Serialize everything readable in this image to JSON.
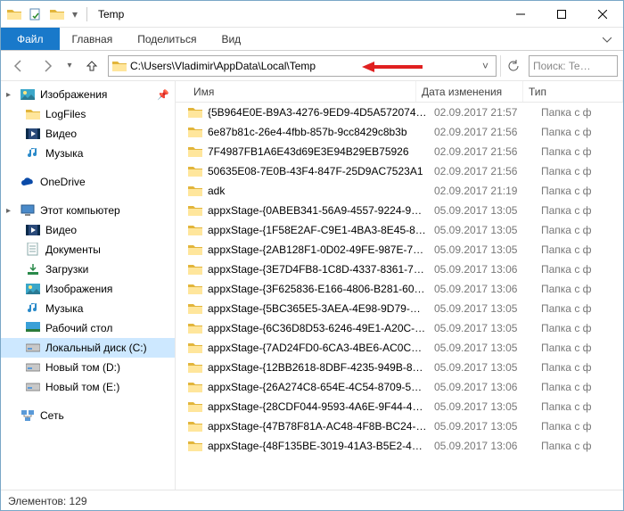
{
  "window": {
    "title": "Temp"
  },
  "ribbon": {
    "file": "Файл",
    "tabs": [
      "Главная",
      "Поделиться",
      "Вид"
    ]
  },
  "address": {
    "path": "C:\\Users\\Vladimir\\AppData\\Local\\Temp",
    "search_placeholder": "Поиск: Te…"
  },
  "sidebar": {
    "groups": [
      {
        "header": {
          "label": "Изображения",
          "icon": "pictures",
          "pin": true
        },
        "items": [
          {
            "label": "LogFiles",
            "icon": "folder"
          },
          {
            "label": "Видео",
            "icon": "video"
          },
          {
            "label": "Музыка",
            "icon": "music"
          }
        ]
      },
      {
        "header": {
          "label": "OneDrive",
          "icon": "onedrive"
        },
        "items": []
      },
      {
        "header": {
          "label": "Этот компьютер",
          "icon": "thispc"
        },
        "items": [
          {
            "label": "Видео",
            "icon": "video"
          },
          {
            "label": "Документы",
            "icon": "documents"
          },
          {
            "label": "Загрузки",
            "icon": "downloads"
          },
          {
            "label": "Изображения",
            "icon": "pictures"
          },
          {
            "label": "Музыка",
            "icon": "music"
          },
          {
            "label": "Рабочий стол",
            "icon": "desktop"
          },
          {
            "label": "Локальный диск (C:)",
            "icon": "disk",
            "selected": true
          },
          {
            "label": "Новый том (D:)",
            "icon": "disk"
          },
          {
            "label": "Новый том (E:)",
            "icon": "disk"
          }
        ]
      },
      {
        "header": {
          "label": "Сеть",
          "icon": "network"
        },
        "items": []
      }
    ]
  },
  "columns": {
    "name": "Имя",
    "date": "Дата изменения",
    "type": "Тип"
  },
  "files": [
    {
      "name": "{5B964E0E-B9A3-4276-9ED9-4D5A572074…",
      "date": "02.09.2017 21:57",
      "type": "Папка с ф"
    },
    {
      "name": "6e87b81c-26e4-4fbb-857b-9cc8429c8b3b",
      "date": "02.09.2017 21:56",
      "type": "Папка с ф"
    },
    {
      "name": "7F4987FB1A6E43d69E3E94B29EB75926",
      "date": "02.09.2017 21:56",
      "type": "Папка с ф"
    },
    {
      "name": "50635E08-7E0B-43F4-847F-25D9AC7523A1",
      "date": "02.09.2017 21:56",
      "type": "Папка с ф"
    },
    {
      "name": "adk",
      "date": "02.09.2017 21:19",
      "type": "Папка с ф"
    },
    {
      "name": "appxStage-{0ABEB341-56A9-4557-9224-9…",
      "date": "05.09.2017 13:05",
      "type": "Папка с ф"
    },
    {
      "name": "appxStage-{1F58E2AF-C9E1-4BA3-8E45-8…",
      "date": "05.09.2017 13:05",
      "type": "Папка с ф"
    },
    {
      "name": "appxStage-{2AB128F1-0D02-49FE-987E-7…",
      "date": "05.09.2017 13:05",
      "type": "Папка с ф"
    },
    {
      "name": "appxStage-{3E7D4FB8-1C8D-4337-8361-7…",
      "date": "05.09.2017 13:06",
      "type": "Папка с ф"
    },
    {
      "name": "appxStage-{3F625836-E166-4806-B281-60…",
      "date": "05.09.2017 13:06",
      "type": "Папка с ф"
    },
    {
      "name": "appxStage-{5BC365E5-3AEA-4E98-9D79-…",
      "date": "05.09.2017 13:05",
      "type": "Папка с ф"
    },
    {
      "name": "appxStage-{6C36D8D53-6246-49E1-A20C-…",
      "date": "05.09.2017 13:05",
      "type": "Папка с ф"
    },
    {
      "name": "appxStage-{7AD24FD0-6CA3-4BE6-AC0C…",
      "date": "05.09.2017 13:05",
      "type": "Папка с ф"
    },
    {
      "name": "appxStage-{12BB2618-8DBF-4235-949B-8…",
      "date": "05.09.2017 13:05",
      "type": "Папка с ф"
    },
    {
      "name": "appxStage-{26A274C8-654E-4C54-8709-5…",
      "date": "05.09.2017 13:06",
      "type": "Папка с ф"
    },
    {
      "name": "appxStage-{28CDF044-9593-4A6E-9F44-4…",
      "date": "05.09.2017 13:05",
      "type": "Папка с ф"
    },
    {
      "name": "appxStage-{47B78F81A-AC48-4F8B-BC24-…",
      "date": "05.09.2017 13:05",
      "type": "Папка с ф"
    },
    {
      "name": "appxStage-{48F135BE-3019-41A3-B5E2-4…",
      "date": "05.09.2017 13:06",
      "type": "Папка с ф"
    }
  ],
  "status": {
    "label": "Элементов:",
    "count": "129"
  }
}
